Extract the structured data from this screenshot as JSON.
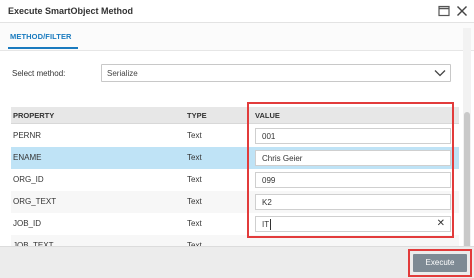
{
  "window": {
    "title": "Execute SmartObject Method"
  },
  "tabs": [
    {
      "label": "METHOD/FILTER",
      "active": true
    }
  ],
  "method": {
    "label": "Select method:",
    "selected": "Serialize"
  },
  "grid": {
    "headers": {
      "property": "PROPERTY",
      "type": "TYPE",
      "value": "VALUE"
    },
    "rows": [
      {
        "property": "PERNR",
        "type": "Text",
        "value": "001"
      },
      {
        "property": "ENAME",
        "type": "Text",
        "value": "Chris Geier",
        "selected": true
      },
      {
        "property": "ORG_ID",
        "type": "Text",
        "value": "099"
      },
      {
        "property": "ORG_TEXT",
        "type": "Text",
        "value": "K2"
      },
      {
        "property": "JOB_ID",
        "type": "Text",
        "value": "IT"
      },
      {
        "property": "JOB_TEXT",
        "type": "Text",
        "value": ""
      }
    ]
  },
  "footer": {
    "execute_label": "Execute"
  },
  "colors": {
    "accent": "#1a7bbf",
    "selected_row": "#bfe3f6",
    "highlight": "#e23b3b",
    "button": "#7e8a94"
  }
}
